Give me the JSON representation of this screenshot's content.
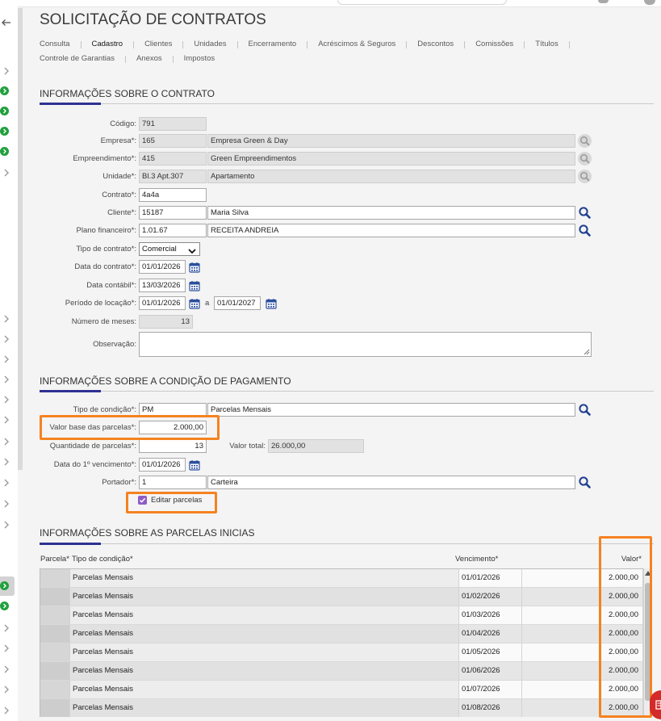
{
  "header": {
    "title": "SOLICITAÇÃO DE CONTRATOS"
  },
  "tabs": {
    "row1": [
      {
        "label": "Consulta"
      },
      {
        "label": "Cadastro",
        "active": true
      },
      {
        "label": "Clientes"
      },
      {
        "label": "Unidades"
      },
      {
        "label": "Encerramento"
      },
      {
        "label": "Acréscimos & Seguros"
      },
      {
        "label": "Descontos"
      },
      {
        "label": "Comissões"
      },
      {
        "label": "Títulos"
      }
    ],
    "row2": [
      {
        "label": "Controle de Garantias"
      },
      {
        "label": "Anexos"
      },
      {
        "label": "Impostos"
      }
    ]
  },
  "contrato": {
    "section_title": "INFORMAÇÕES SOBRE O CONTRATO",
    "codigo": {
      "label": "Código:",
      "value": "791"
    },
    "empresa": {
      "label": "Empresa*:",
      "code": "165",
      "name": "Empresa Green & Day"
    },
    "empreendimento": {
      "label": "Empreendimento*:",
      "code": "415",
      "name": "Green Empreendimentos"
    },
    "unidade": {
      "label": "Unidade*:",
      "code": "Bl.3 Apt.307",
      "name": "Apartamento"
    },
    "contrato": {
      "label": "Contrato*:",
      "value": "4a4a"
    },
    "cliente": {
      "label": "Cliente*:",
      "code": "15187",
      "name": "Maria Silva"
    },
    "plano_financeiro": {
      "label": "Plano financeiro*:",
      "code": "1.01.67",
      "name": "RECEITA ANDREIA"
    },
    "tipo_contrato": {
      "label": "Tipo de contrato*:",
      "value": "Comercial"
    },
    "data_contrato": {
      "label": "Data do contrato*:",
      "value": "01/01/2026"
    },
    "data_contabil": {
      "label": "Data contábil*:",
      "value": "13/03/2026"
    },
    "periodo_locacao": {
      "label": "Período de locação*:",
      "start": "01/01/2026",
      "separator": "a",
      "end": "01/01/2027"
    },
    "numero_meses": {
      "label": "Número de meses:",
      "value": "13"
    },
    "observacao": {
      "label": "Observação:",
      "value": ""
    }
  },
  "pagamento": {
    "section_title": "INFORMAÇÕES SOBRE A CONDIÇÃO DE PAGAMENTO",
    "tipo_condicao": {
      "label": "Tipo de condição*:",
      "code": "PM",
      "name": "Parcelas Mensais"
    },
    "valor_base": {
      "label": "Valor base das parcelas*:",
      "value": "2.000,00"
    },
    "quantidade": {
      "label": "Quantidade de parcelas*:",
      "value": "13"
    },
    "valor_total": {
      "label": "Valor total:",
      "value": "26.000,00"
    },
    "data_vencimento": {
      "label": "Data do 1º vencimento*:",
      "value": "01/01/2026"
    },
    "portador": {
      "label": "Portador*:",
      "code": "1",
      "name": "Carteira"
    },
    "editar_parcelas": {
      "label": "Editar parcelas",
      "checked": true
    }
  },
  "parcelas": {
    "section_title": "INFORMAÇÕES SOBRE AS PARCELAS INICIAS",
    "columns": {
      "parcela": "Parcela*",
      "tipo": "Tipo de condição*",
      "vencimento": "Vencimento*",
      "valor": "Valor*"
    },
    "rows": [
      {
        "tipo": "Parcelas Mensais",
        "vencimento": "01/01/2026",
        "valor": "2.000,00"
      },
      {
        "tipo": "Parcelas Mensais",
        "vencimento": "01/02/2026",
        "valor": "2.000,00"
      },
      {
        "tipo": "Parcelas Mensais",
        "vencimento": "01/03/2026",
        "valor": "2.000,00"
      },
      {
        "tipo": "Parcelas Mensais",
        "vencimento": "01/04/2026",
        "valor": "2.000,00"
      },
      {
        "tipo": "Parcelas Mensais",
        "vencimento": "01/05/2026",
        "valor": "2.000,00"
      },
      {
        "tipo": "Parcelas Mensais",
        "vencimento": "01/06/2026",
        "valor": "2.000,00"
      },
      {
        "tipo": "Parcelas Mensais",
        "vencimento": "01/07/2026",
        "valor": "2.000,00"
      },
      {
        "tipo": "Parcelas Mensais",
        "vencimento": "01/08/2026",
        "valor": "2.000,00"
      }
    ]
  },
  "colors": {
    "accent": "#2e3192",
    "highlight": "#f58220",
    "checkbox": "#8e5cc5",
    "search_icon": "#1e3f8f",
    "sidebar_status": "#21a03d",
    "floating_button": "#d32a2a"
  },
  "icons": [
    "arrow-left-icon",
    "chevron-right-icon",
    "status-chevron-icon",
    "search-icon",
    "calendar-icon",
    "chevron-down-icon",
    "checkbox-checked-icon",
    "resize-grip-icon",
    "scroll-up-icon",
    "document-icon"
  ]
}
